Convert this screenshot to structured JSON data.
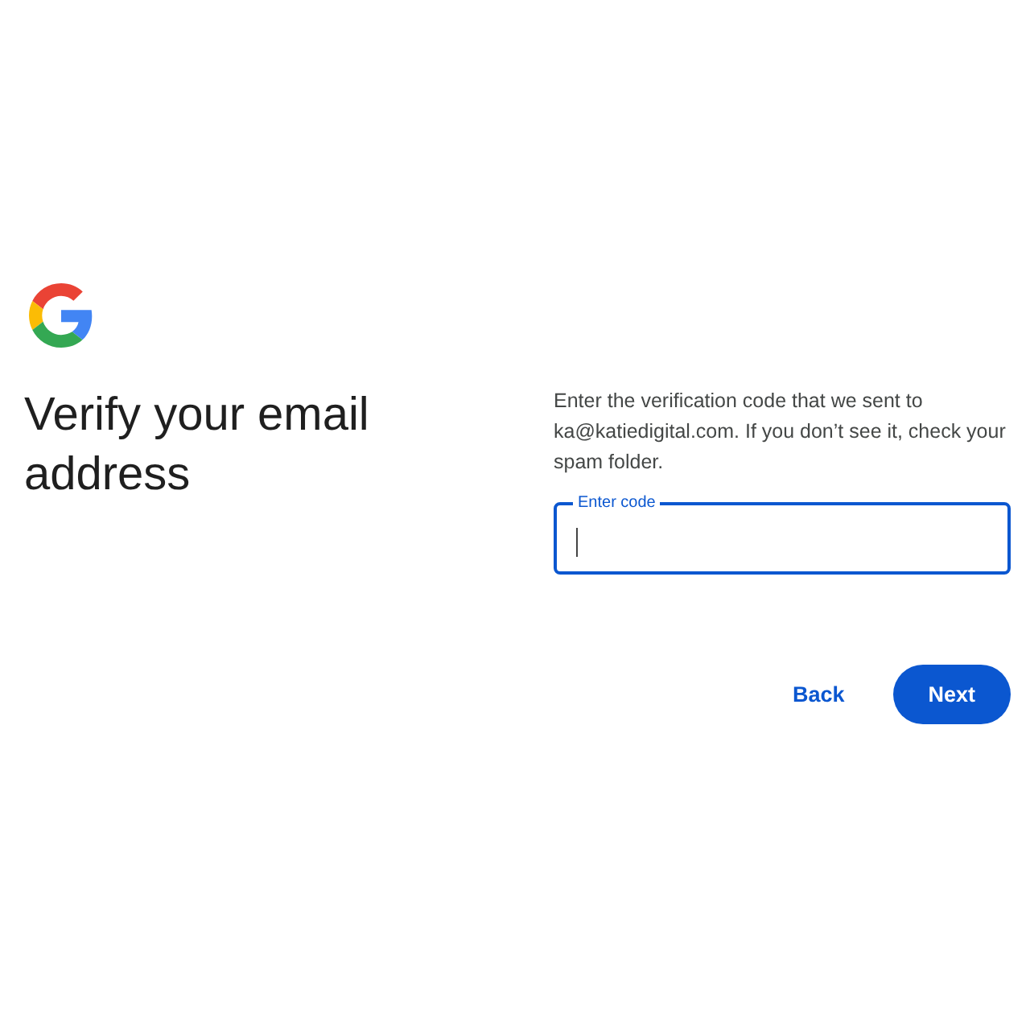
{
  "heading": "Verify your email address",
  "instructions": "Enter the verification code that we sent to ka@katiedigital.com. If you don’t see it, check your spam folder.",
  "code_field": {
    "label": "Enter code",
    "focused": true
  },
  "buttons": [
    {
      "label": "Back",
      "kind": "text"
    },
    {
      "label": "Next",
      "kind": "filled"
    }
  ]
}
